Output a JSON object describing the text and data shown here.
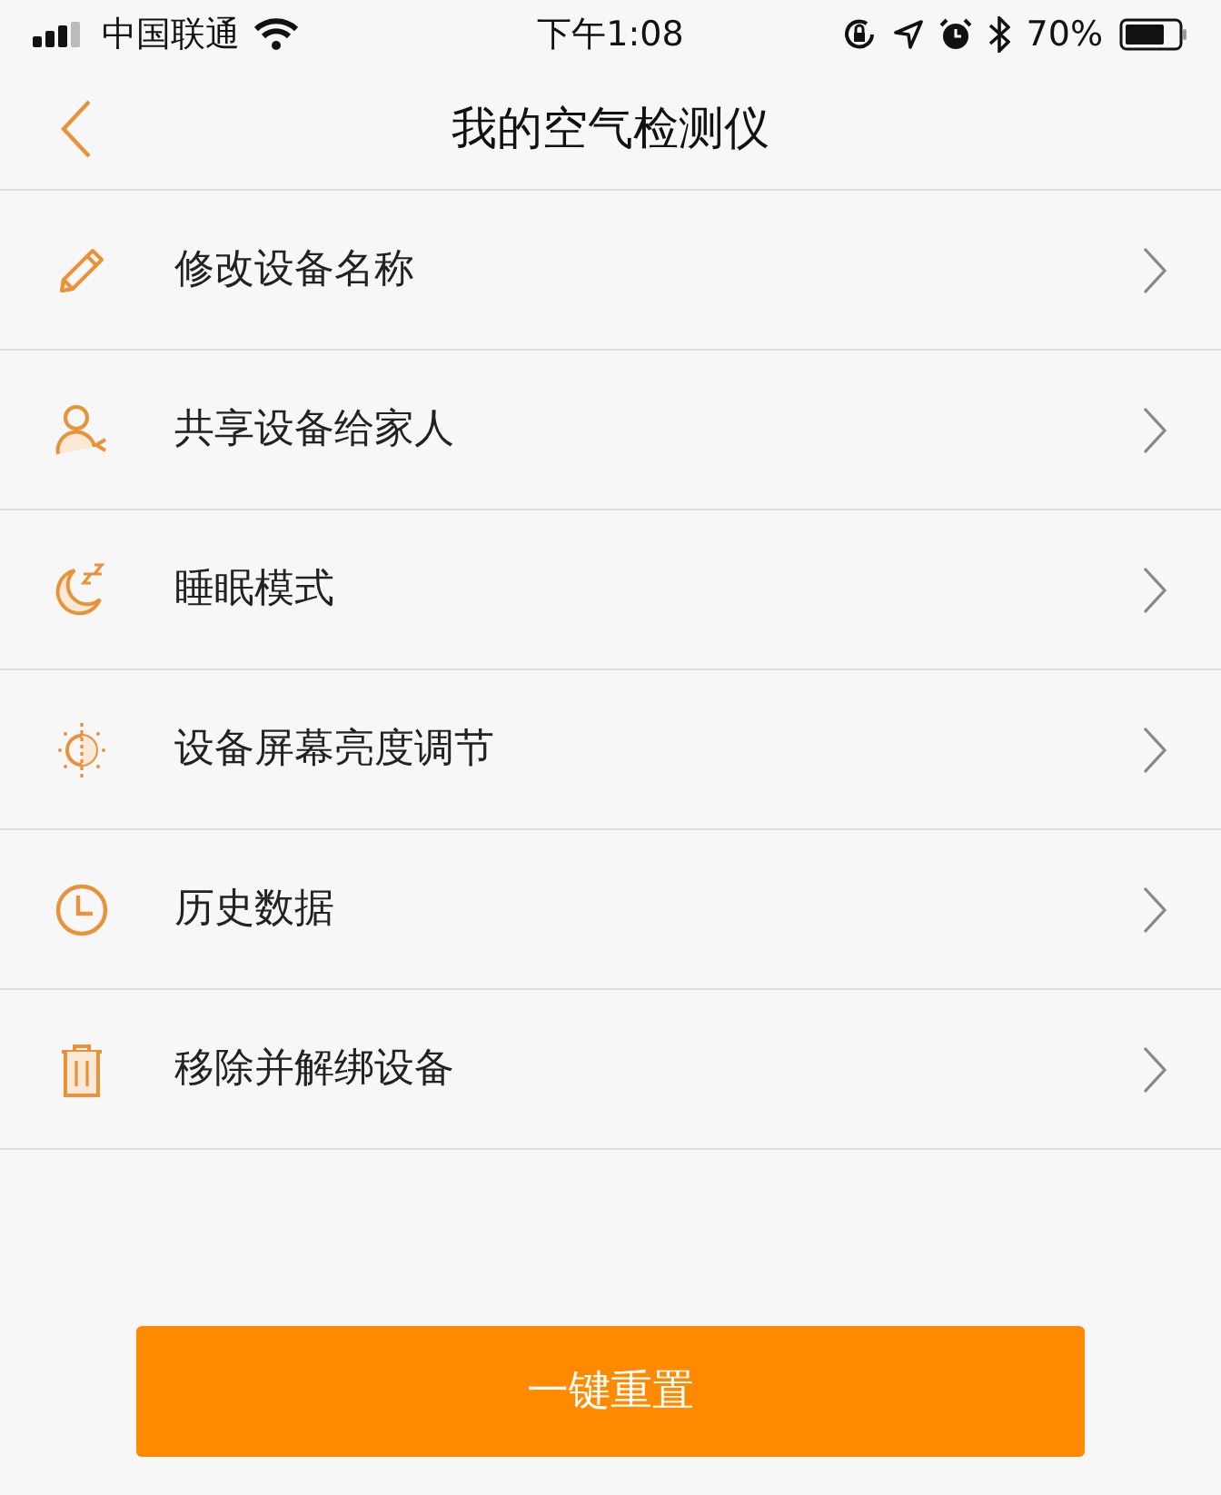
{
  "status_bar": {
    "carrier": "中国联通",
    "time": "下午1:08",
    "battery": "70%"
  },
  "nav": {
    "title": "我的空气检测仪"
  },
  "menu": [
    {
      "kind": "pencil",
      "label": "修改设备名称"
    },
    {
      "kind": "person",
      "label": "共享设备给家人"
    },
    {
      "kind": "moon",
      "label": "睡眠模式"
    },
    {
      "kind": "brightness",
      "label": "设备屏幕亮度调节"
    },
    {
      "kind": "clock",
      "label": "历史数据"
    },
    {
      "kind": "trash",
      "label": "移除并解绑设备"
    }
  ],
  "reset_button": "一键重置"
}
